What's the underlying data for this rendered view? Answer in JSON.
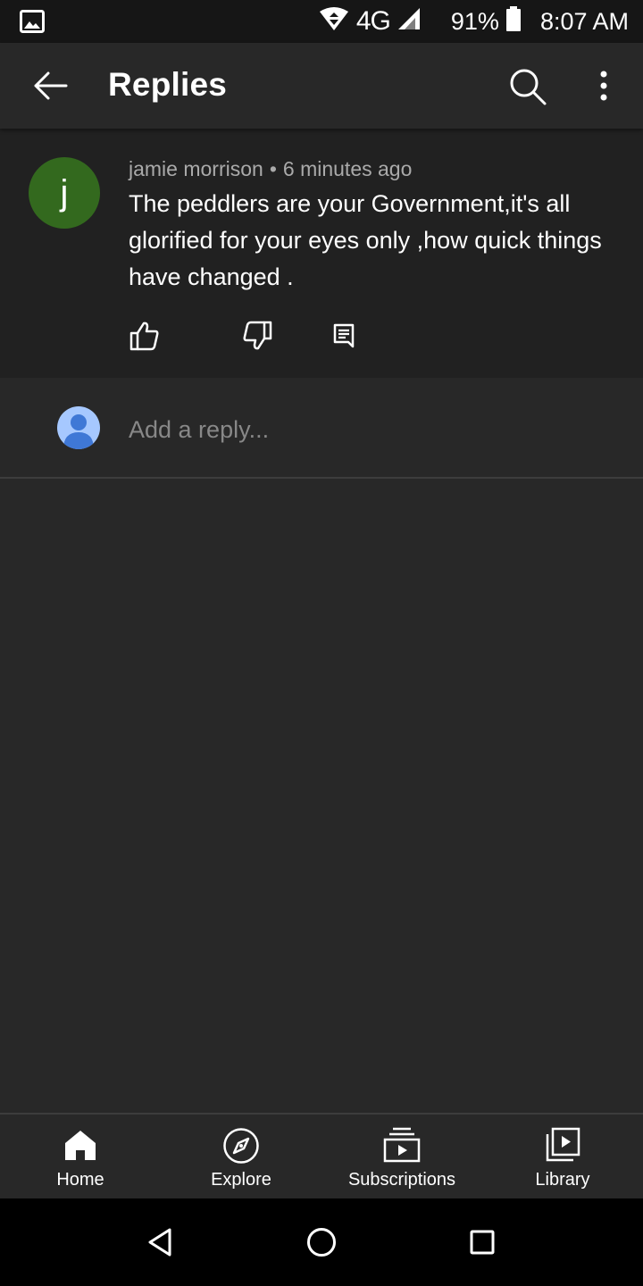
{
  "status_bar": {
    "network": "4G",
    "battery": "91%",
    "time": "8:07 AM"
  },
  "app_bar": {
    "title": "Replies"
  },
  "comment": {
    "avatar_letter": "j",
    "avatar_color": "#33691e",
    "author": "jamie morrison",
    "separator": "•",
    "time_ago": "6 minutes ago",
    "text": "The peddlers are your Government,it's all glorified for your eyes only ,how quick things have changed ."
  },
  "reply": {
    "placeholder": "Add a reply..."
  },
  "bottom_nav": {
    "items": [
      {
        "label": "Home",
        "icon": "home-icon"
      },
      {
        "label": "Explore",
        "icon": "compass-icon"
      },
      {
        "label": "Subscriptions",
        "icon": "subscriptions-icon"
      },
      {
        "label": "Library",
        "icon": "library-icon"
      }
    ]
  },
  "colors": {
    "background": "#282828",
    "comment_background": "#212121",
    "status_bar": "#161616",
    "user_avatar": "#a6c8ff",
    "user_avatar_figure": "#3f78d6"
  }
}
